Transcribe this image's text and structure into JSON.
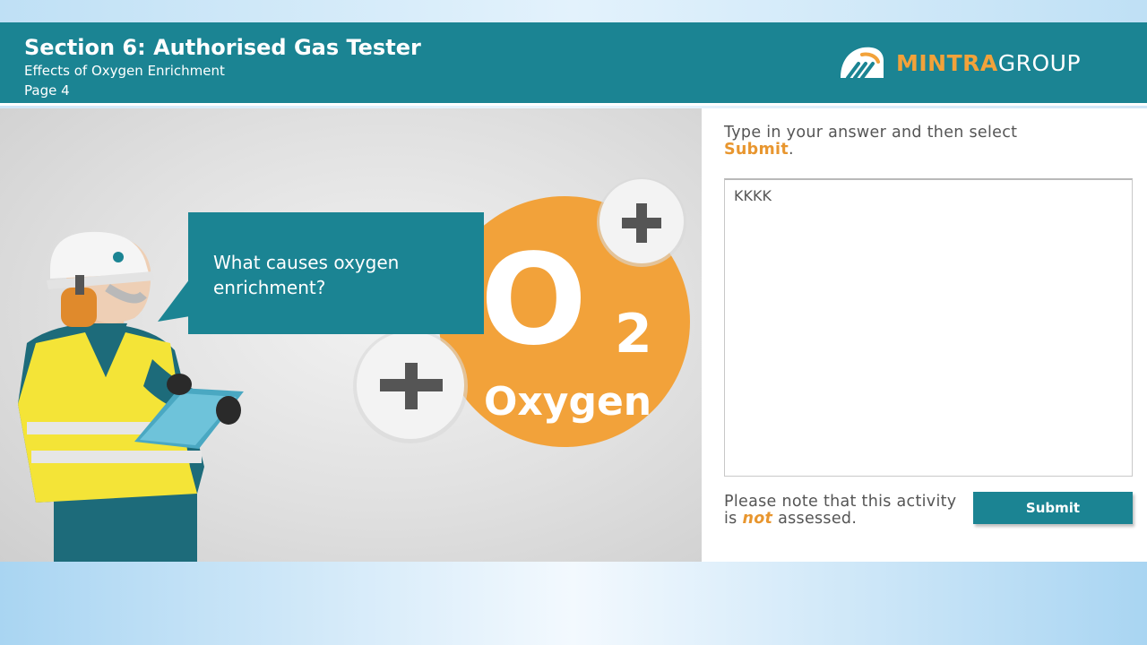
{
  "header": {
    "title": "Section 6: Authorised Gas Tester",
    "subtitle": "Effects of Oxygen Enrichment",
    "page_label": "Page 4"
  },
  "logo": {
    "text_primary": "MINTRA",
    "text_secondary": "GROUP",
    "icon": "mintra-logo-icon"
  },
  "scene": {
    "question": "What causes oxygen enrichment?",
    "o2_symbol": "O",
    "o2_subscript": "2",
    "o2_label": "Oxygen",
    "icons": [
      "plus-icon",
      "plus-icon",
      "worker-illustration",
      "clipboard-icon",
      "ear-defenders-icon"
    ]
  },
  "panel": {
    "instruction_prefix": "Type in your answer and then select",
    "instruction_keyword": "Submit",
    "instruction_suffix": ".",
    "answer_value": "KKKK",
    "note_prefix": "Please note that this activity is",
    "note_emphasis": "not",
    "note_suffix": "assessed.",
    "submit_label": "Submit"
  },
  "colors": {
    "teal": "#1b8493",
    "orange": "#f2a23a",
    "accent_text": "#e8962f"
  }
}
